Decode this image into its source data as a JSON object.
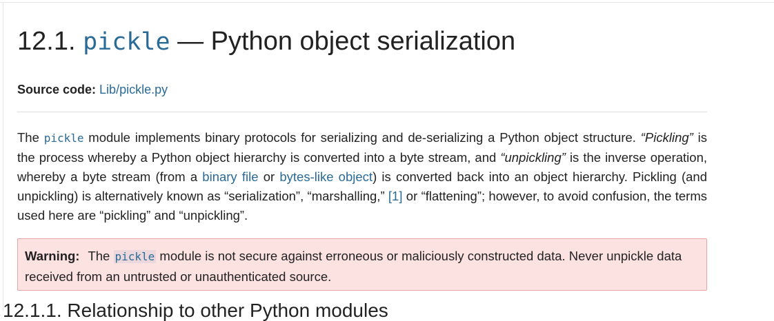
{
  "heading": {
    "number": "12.1.",
    "module": "pickle",
    "title": "— Python object serialization"
  },
  "source": {
    "label": "Source code:",
    "link": "Lib/pickle.py"
  },
  "intro": {
    "t1": "The ",
    "code1": "pickle",
    "t2": " module implements binary protocols for serializing and de-serializing a Python object structure. ",
    "pickling": "“Pickling”",
    "t3": " is the process whereby a Python object hierarchy is converted into a byte stream, and ",
    "unpickling": "“unpickling”",
    "t4": " is the inverse operation, whereby a byte stream (from a ",
    "link_binary_file": "binary file",
    "t5": " or ",
    "link_bytes_like": "bytes-like object",
    "t6": ") is converted back into an object hierarchy. Pickling (and unpickling) is alternatively known as “serialization”, “marshalling,” ",
    "footnote": "[1]",
    "t7": " or “flattening”; however, to avoid confusion, the terms used here are “pickling” and “unpickling”."
  },
  "warning": {
    "label": "Warning:",
    "t1": "The ",
    "code": "pickle",
    "t2": " module is not secure against erroneous or maliciously constructed data. Never unpickle data received from an untrusted or unauthenticated source."
  },
  "next_heading": "12.1.1. Relationship to other Python modules"
}
